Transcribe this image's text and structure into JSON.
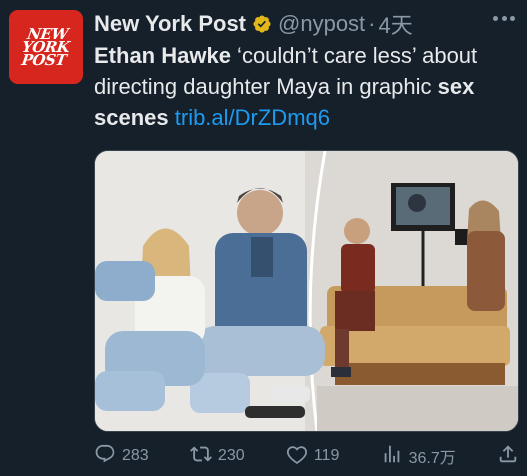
{
  "account": {
    "avatar_text": [
      "NEW",
      "YORK",
      "POST"
    ],
    "name": "New York Post",
    "handle": "@nypost",
    "separator": "·",
    "time": "4天"
  },
  "tweet": {
    "part1_bold": "Ethan Hawke",
    "part2": " ‘couldn’t care less’ about directing daughter Maya in graphic ",
    "part3_bold": "sex scenes",
    "link": "trib.al/DrZDmq6"
  },
  "actions": {
    "replies": "283",
    "retweets": "230",
    "likes": "119",
    "views": "36.7万"
  },
  "colors": {
    "background": "#15202b",
    "accent": "#1d9bf0",
    "muted": "#8b98a5",
    "brand": "#d6261d"
  }
}
